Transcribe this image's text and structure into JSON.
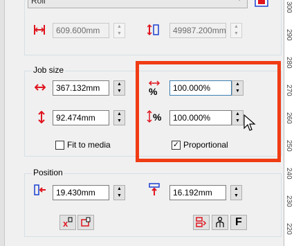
{
  "media": {
    "selected": "Roll"
  },
  "media_size": {
    "width_value": "609.600mm",
    "height_value": "49987.200mm"
  },
  "job_size": {
    "title": "Job size",
    "width_value": "367.132mm",
    "height_value": "92.474mm",
    "width_percent": "100.000%",
    "height_percent": "100.000%",
    "fit_to_media_label": "Fit to media",
    "fit_to_media_checked": false,
    "proportional_label": "Proportional",
    "proportional_checked": true
  },
  "position": {
    "title": "Position",
    "x_value": "19.430mm",
    "y_value": "16.192mm",
    "font_button_label": "F"
  },
  "ruler": {
    "labels": [
      "300",
      "290",
      "280",
      "270",
      "260",
      "250",
      "240",
      "230",
      "220"
    ]
  },
  "colors": {
    "accent_icon": "#e0141e",
    "annotation_border": "#f03c14",
    "focus_border": "#3c7fb1",
    "highlight_blue": "#1a3fd0"
  }
}
